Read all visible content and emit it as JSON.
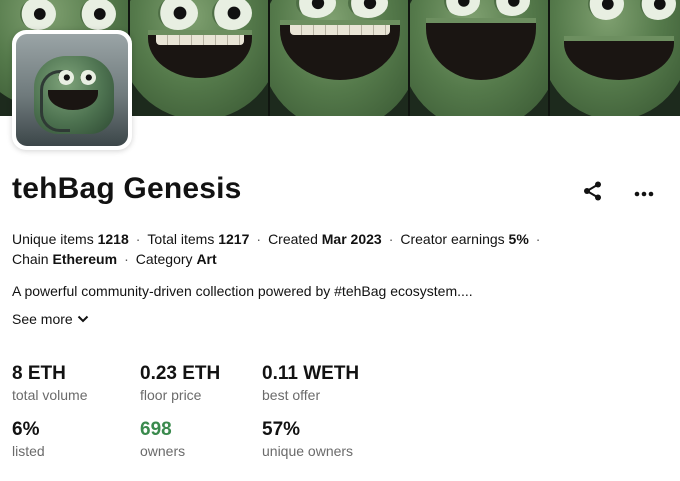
{
  "collection": {
    "name": "tehBag Genesis",
    "meta": {
      "unique_items_label": "Unique items",
      "unique_items_value": "1218",
      "total_items_label": "Total items",
      "total_items_value": "1217",
      "created_label": "Created",
      "created_value": "Mar 2023",
      "creator_earnings_label": "Creator earnings",
      "creator_earnings_value": "5%",
      "chain_label": "Chain",
      "chain_value": "Ethereum",
      "category_label": "Category",
      "category_value": "Art",
      "separator": "·"
    },
    "description": "A powerful community-driven collection powered by #tehBag ecosystem....",
    "see_more_label": "See more"
  },
  "stats": [
    {
      "value": "8 ETH",
      "label": "total volume"
    },
    {
      "value": "0.23 ETH",
      "label": "floor price"
    },
    {
      "value": "0.11 WETH",
      "label": "best offer"
    },
    {
      "value": "6%",
      "label": "listed"
    },
    {
      "value": "698",
      "label": "owners"
    },
    {
      "value": "57%",
      "label": "unique owners"
    }
  ],
  "icons": {
    "share": "share-icon",
    "more": "more-options-icon",
    "chevron": "chevron-down-icon"
  },
  "colors": {
    "accent_green": "#3a8a4d",
    "text": "#121212",
    "muted": "#6b6b6b"
  }
}
